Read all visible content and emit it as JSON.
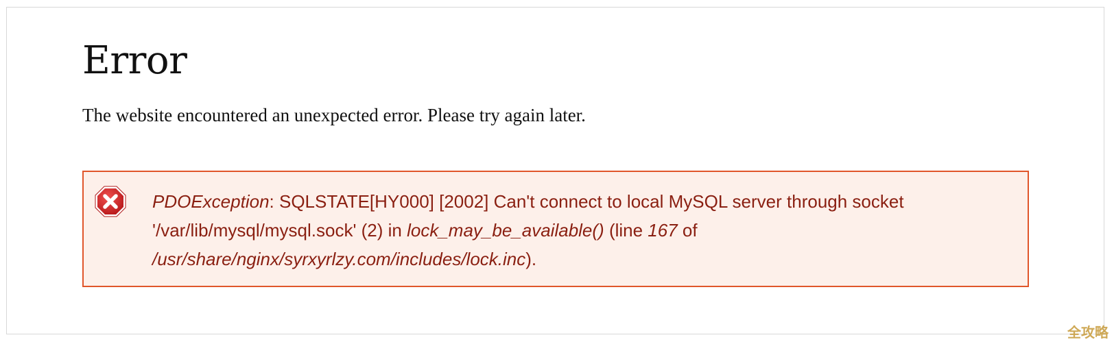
{
  "page": {
    "title": "Error",
    "subtitle": "The website encountered an unexpected error. Please try again later."
  },
  "error": {
    "icon": "error-x-icon",
    "exception_class": "PDOException",
    "message_part1": ": SQLSTATE[HY000] [2002] Can't connect to local MySQL server through socket '/var/lib/mysql/mysql.sock' (2) in ",
    "function": "lock_may_be_available()",
    "message_part2": " (line ",
    "line": "167",
    "message_part3": " of ",
    "file": "/usr/share/nginx/syrxyrlzy.com/includes/lock.inc",
    "message_part4": ")."
  },
  "colors": {
    "box_border": "#e0552a",
    "box_background": "#fdf0ea",
    "message_text": "#8a1f11",
    "icon_red": "#d6282b"
  },
  "watermark": "全攻略"
}
